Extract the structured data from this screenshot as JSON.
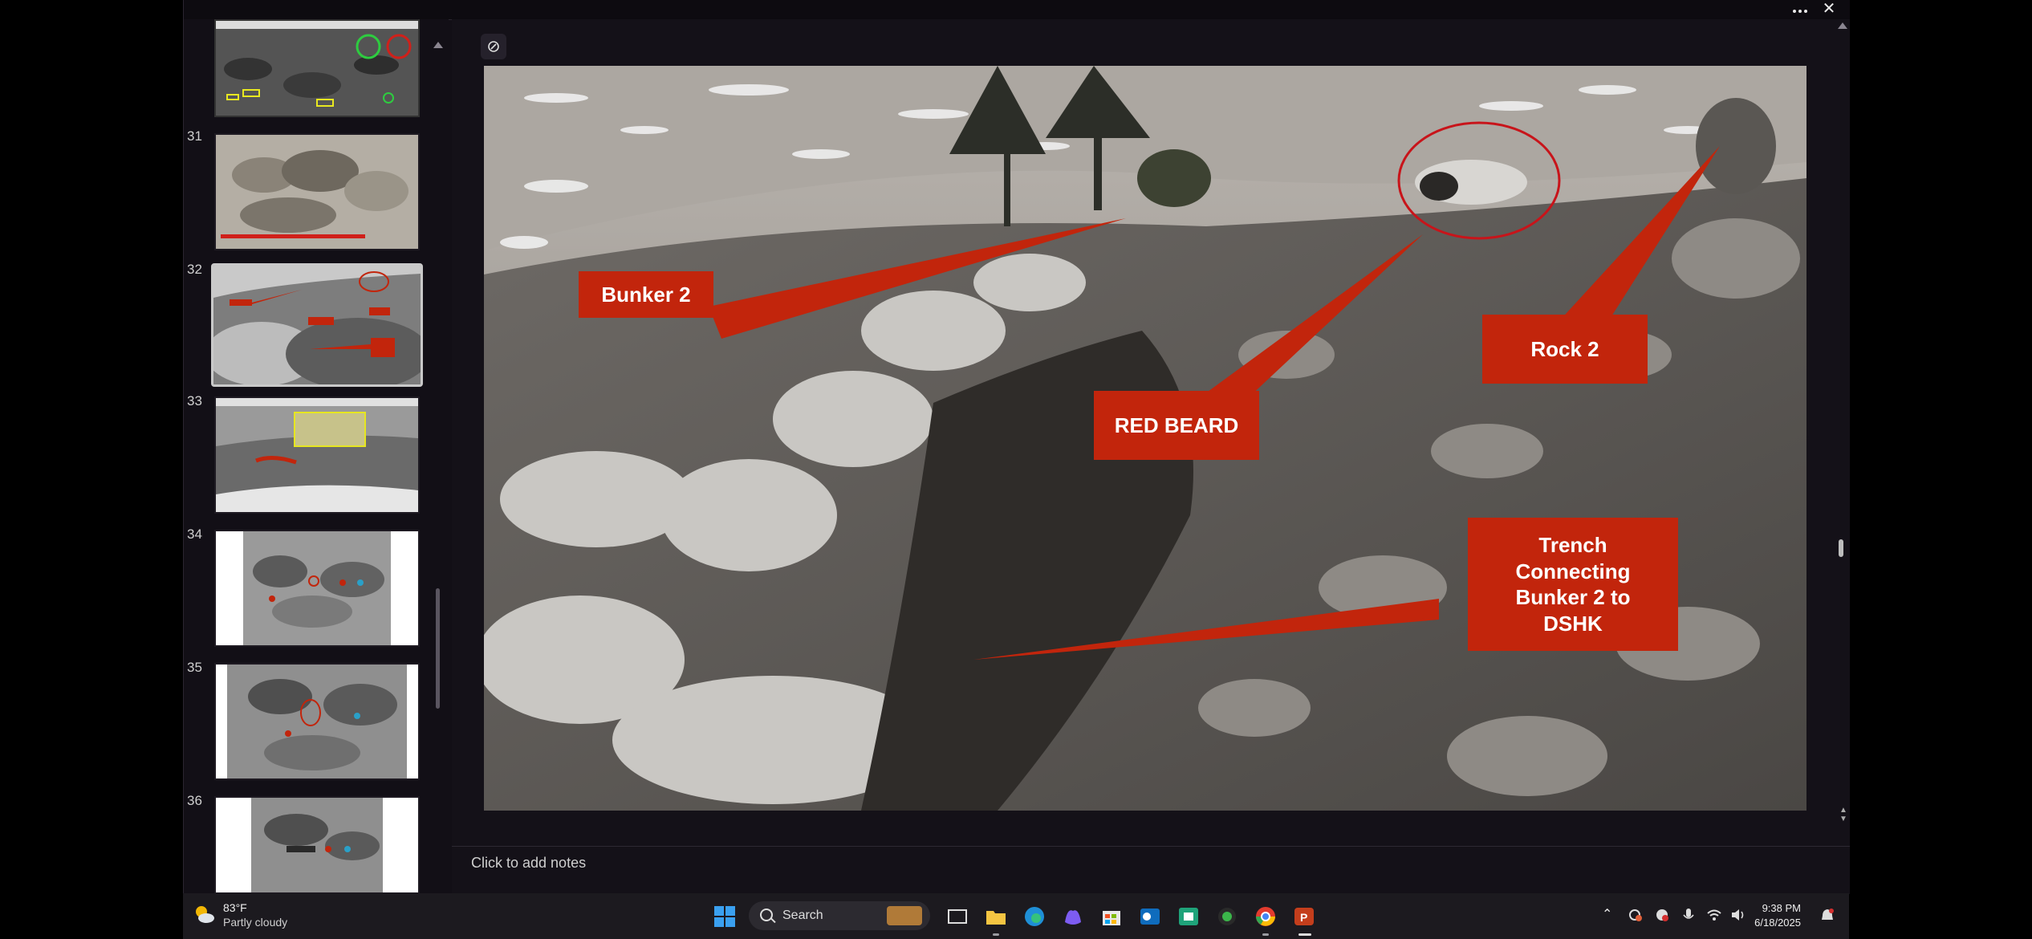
{
  "titlebar": {
    "more_icon": "more-horizontal-icon",
    "close_label": "✕"
  },
  "thumbnails": [
    {
      "num": "",
      "label": "slide-30-partial"
    },
    {
      "num": "31",
      "caption": ""
    },
    {
      "num": "32",
      "selected": true
    },
    {
      "num": "33"
    },
    {
      "num": "34"
    },
    {
      "num": "35"
    },
    {
      "num": "36"
    }
  ],
  "slide": {
    "callouts": {
      "bunker2": "Bunker 2",
      "red_beard": "RED BEARD",
      "rock2": "Rock 2",
      "trench_line1": "Trench",
      "trench_line2": "Connecting",
      "trench_line3": "Bunker 2 to",
      "trench_line4": "DSHK"
    },
    "callout_color": "#c2250c"
  },
  "notes": {
    "placeholder": "Click to add notes"
  },
  "taskbar": {
    "weather_temp": "83°F",
    "weather_desc": "Partly cloudy",
    "search_label": "Search",
    "time": "9:38 PM",
    "date": "6/18/2025"
  }
}
